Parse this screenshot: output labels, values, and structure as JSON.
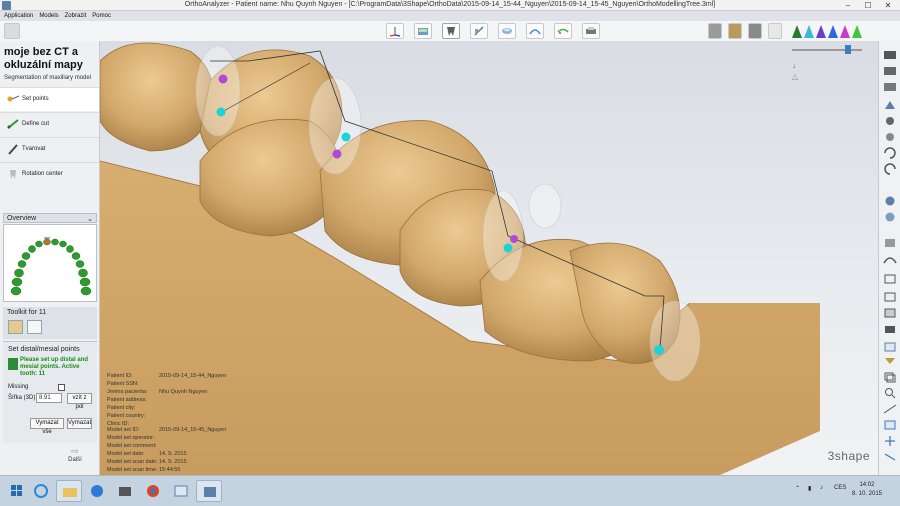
{
  "window": {
    "title": "OrthoAnalyzer - Patient name: Nhu Quynh Nguyen - [C:\\ProgramData\\3Shape\\OrthoData\\2015-09-14_15-44_Nguyen\\2015-09-14_15-45_Nguyen\\OrthoModellingTree.3ml]",
    "minimize": "–",
    "maximize": "☐",
    "close": "✕"
  },
  "menu": [
    "Application",
    "Models",
    "Zobrazit",
    "Pomoc"
  ],
  "toolbar": {
    "icons": [
      "axis-icon",
      "model-view-icon",
      "tooth-icon",
      "bracket-icon",
      "scan-icon",
      "arch-icon",
      "occlusion-icon",
      "printer-icon"
    ],
    "active_index": 2
  },
  "left_panel": {
    "title": "moje bez CT a okluzální mapy",
    "subtitle": "Segmentation of maxillary model",
    "steps": [
      {
        "label": "Set points",
        "active": true
      },
      {
        "label": "Define cut",
        "active": false
      },
      {
        "label": "Tvarovat",
        "active": false
      },
      {
        "label": "Rotation center",
        "active": false
      }
    ],
    "overview_label": "Overview",
    "toolkit_label": "Toolkit for 11",
    "set_points": {
      "heading": "Set distal/mesial points",
      "message": "Please set up distal and mesial points. Active tooth: 11",
      "missing_label": "Missing",
      "width_label": "Šířka (3D)",
      "width_value": "8.91",
      "from_pol_label": "vzít z pol",
      "clear_all_label": "Vymazat vše",
      "clear_label": "Vymazat"
    },
    "next_label": "Další"
  },
  "patient_info": [
    {
      "key": "Patient ID:",
      "value": "2015-09-14_15-44_Nguyen"
    },
    {
      "key": "Patient SSN:",
      "value": ""
    },
    {
      "key": "Jméno pacienta:",
      "value": "Nhu Quynh Nguyen"
    },
    {
      "key": "Patient address:",
      "value": ""
    },
    {
      "key": "Patient city:",
      "value": ""
    },
    {
      "key": "Patient country:",
      "value": ""
    },
    {
      "key": "Clinic ID:",
      "value": ""
    }
  ],
  "model_info": [
    {
      "key": "Model set ID:",
      "value": "2015-09-14_15-45_Nguyen"
    },
    {
      "key": "Model set operator:",
      "value": ""
    },
    {
      "key": "Model set comment:",
      "value": ""
    },
    {
      "key": "Model set date:",
      "value": "14. 9. 2015"
    },
    {
      "key": "Model set scan date:",
      "value": "14. 9. 2015"
    },
    {
      "key": "Model set scan time:",
      "value": "15:44:55"
    }
  ],
  "brand": "3shape",
  "taskbar": {
    "language": "CES",
    "time": "14:02",
    "date": "8. 10. 2015"
  },
  "colors": {
    "tooth": "#d9b27a",
    "tooth_shadow": "#b88f55",
    "point_cyan": "#1fd2d6",
    "point_purple": "#b04ad6"
  }
}
